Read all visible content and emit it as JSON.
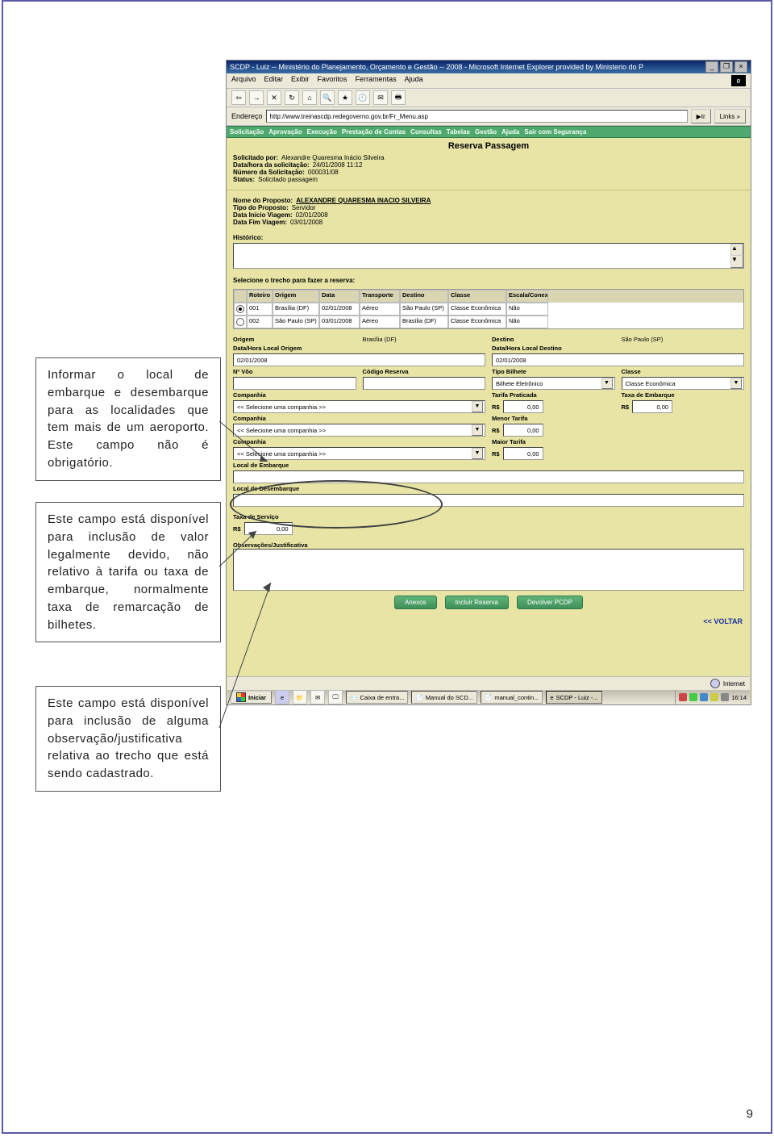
{
  "callouts": {
    "c1": "Informar o local de embarque e desembarque para as localidades que tem mais de um aeroporto. Este campo não é obrigatório.",
    "c2": "Este campo está disponível para inclusão de valor legalmente devido, não relativo à tarifa ou taxa de embarque, normalmente taxa de remarcação de bilhetes.",
    "c3": "Este campo está disponível para inclusão de alguma observação/justificativa relativa ao trecho que está sendo cadastrado."
  },
  "page_number": "9",
  "browser": {
    "title": "SCDP - Luiz -- Ministério do Planejamento, Orçamento e Gestão -- 2008 - Microsoft Internet Explorer provided by Ministerio do P",
    "menu": [
      "Arquivo",
      "Editar",
      "Exibir",
      "Favoritos",
      "Ferramentas",
      "Ajuda"
    ],
    "addr_label": "Endereço",
    "url": "http://www.treinascdp.redegoverno.gov.br/Fr_Menu.asp",
    "go": "Ir",
    "links": "Links »",
    "statusbar_zone": "Internet"
  },
  "nav": [
    "Solicitação",
    "Aprovação",
    "Execução",
    "Prestação de Contas",
    "Consultas",
    "Tabelas",
    "Gestão",
    "Ajuda",
    "Sair com Segurança"
  ],
  "page_title": "Reserva Passagem",
  "header": {
    "solicitado_por_k": "Solicitado por:",
    "solicitado_por_v": "Alexandre Quaresma Inácio Silveira",
    "data_hora_k": "Data/hora da solicitação:",
    "data_hora_v": "24/01/2008 11:12",
    "num_solic_k": "Número da Solicitação:",
    "num_solic_v": "000031/08",
    "status_k": "Status:",
    "status_v": "Solicitado passagem"
  },
  "proposto": {
    "nome_k": "Nome do Proposto:",
    "nome_v": "ALEXANDRE QUARESMA INACIO SILVEIRA",
    "tipo_k": "Tipo do Proposto:",
    "tipo_v": "Servidor",
    "ini_k": "Data Início Viagem:",
    "ini_v": "02/01/2008",
    "fim_k": "Data Fim Viagem:",
    "fim_v": "03/01/2008"
  },
  "historico_label": "Histórico:",
  "trecho_label": "Selecione o trecho para fazer a reserva:",
  "trecho_headers": [
    "",
    "Roteiro",
    "Origem",
    "Data",
    "Transporte",
    "Destino",
    "Classe",
    "Escala/Conexão"
  ],
  "trecho_rows": [
    {
      "checked": true,
      "roteiro": "001",
      "origem": "Brasília (DF)",
      "data": "02/01/2008",
      "transporte": "Aéreo",
      "destino": "São Paulo (SP)",
      "classe": "Classe Econômica",
      "escala": "Não"
    },
    {
      "checked": false,
      "roteiro": "002",
      "origem": "São Paulo (SP)",
      "data": "03/01/2008",
      "transporte": "Aéreo",
      "destino": "Brasília (DF)",
      "classe": "Classe Econômica",
      "escala": "Não"
    }
  ],
  "form": {
    "origem_lbl": "Origem",
    "origem_val": "Brasília (DF)",
    "destino_lbl": "Destino",
    "destino_val": "São Paulo (SP)",
    "dhlo_lbl": "Data/Hora Local Origem",
    "dhlo_val": "02/01/2008",
    "dhld_lbl": "Data/Hora Local Destino",
    "dhld_val": "02/01/2008",
    "nvoo_lbl": "Nº Vôo",
    "codres_lbl": "Código Reserva",
    "tipobilhete_lbl": "Tipo Bilhete",
    "tipobilhete_val": "Bilhete Eletrônico",
    "classe_lbl": "Classe",
    "classe_val": "Classe Econômica",
    "companhia_lbl": "Companhia",
    "companhia_sel": "<< Selecione uma companhia >>",
    "tarifa_praticada_lbl": "Tarifa Praticada",
    "taxa_embarque_lbl": "Taxa de Embarque",
    "menor_tarifa_lbl": "Menor Tarifa",
    "maior_tarifa_lbl": "Maior Tarifa",
    "currency": "R$",
    "zero": "0,00",
    "local_embarque_lbl": "Local de Embarque",
    "local_desembarque_lbl": "Local de Desembarque",
    "taxa_servico_lbl": "Taxa de Serviço",
    "obs_lbl": "Observações/Justificativa"
  },
  "buttons": {
    "anexos": "Anexos",
    "incluir": "Incluir Reserva",
    "devolver": "Devolver PCDP",
    "voltar": "<< VOLTAR"
  },
  "taskbar": {
    "start": "Iniciar",
    "items": [
      "Caixa de entra...",
      "Manual do SCD...",
      "manual_contin...",
      "SCDP - Luiz -..."
    ],
    "clock": "16:14"
  }
}
